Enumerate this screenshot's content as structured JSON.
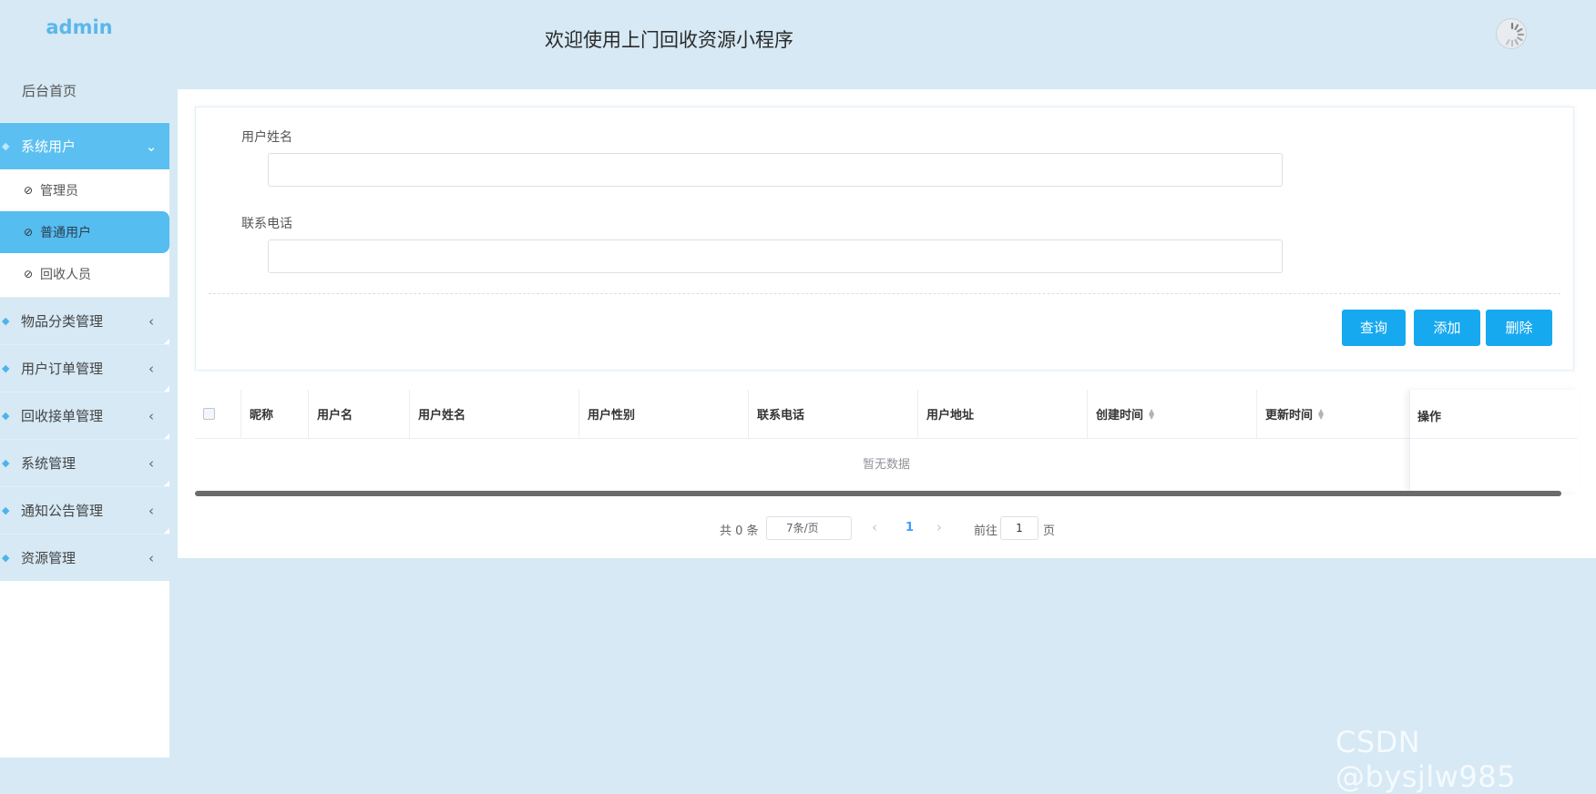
{
  "sidebar": {
    "logo": "admin",
    "home": "后台首页",
    "active_group": {
      "label": "系统用户"
    },
    "sub_items": [
      {
        "label": "管理员"
      },
      {
        "label": "普通用户"
      },
      {
        "label": "回收人员"
      }
    ],
    "groups": [
      {
        "label": "物品分类管理"
      },
      {
        "label": "用户订单管理"
      },
      {
        "label": "回收接单管理"
      },
      {
        "label": "系统管理"
      },
      {
        "label": "通知公告管理"
      },
      {
        "label": "资源管理"
      }
    ]
  },
  "header": {
    "title": "欢迎使用上门回收资源小程序"
  },
  "search": {
    "name_label": "用户姓名",
    "name_value": "",
    "phone_label": "联系电话",
    "phone_value": ""
  },
  "buttons": {
    "query": "查询",
    "add": "添加",
    "delete": "删除"
  },
  "table": {
    "columns": [
      "昵称",
      "用户名",
      "用户姓名",
      "用户性别",
      "联系电话",
      "用户地址",
      "创建时间",
      "更新时间"
    ],
    "ops": "操作",
    "empty": "暂无数据"
  },
  "pagination": {
    "total": "共 0 条",
    "page_size": "7条/页",
    "current_page": "1",
    "goto_label": "前往",
    "goto_value": "1",
    "page_suffix": "页"
  },
  "watermark": "CSDN @bysjlw985"
}
